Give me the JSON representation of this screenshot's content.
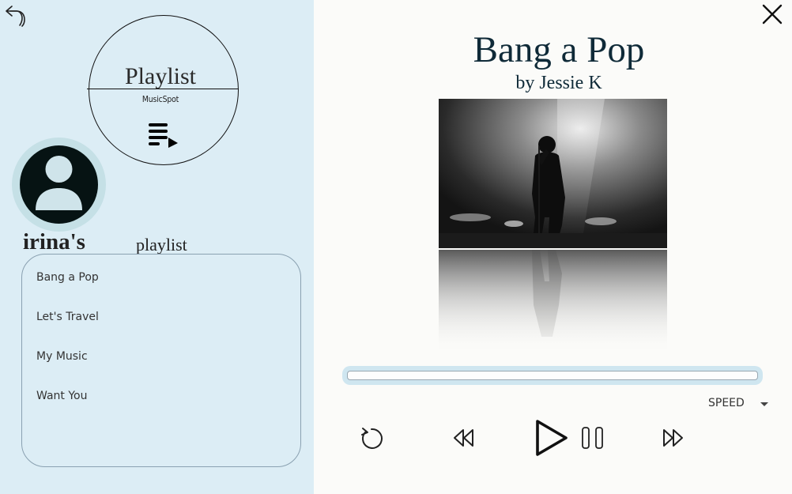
{
  "header": {
    "back_icon": "undo-arrow-icon",
    "close_icon": "close-x-icon"
  },
  "logo": {
    "title": "Playlist",
    "subtitle": "MusicSpot",
    "icon": "playlist-play-icon"
  },
  "user": {
    "avatar_icon": "user-avatar-icon",
    "name": "irina's",
    "suffix": "playlist"
  },
  "playlist": {
    "items": [
      {
        "label": "Bang a Pop"
      },
      {
        "label": "Let's Travel"
      },
      {
        "label": "My Music"
      },
      {
        "label": "Want You"
      }
    ]
  },
  "now_playing": {
    "title": "Bang a Pop",
    "artist": "by Jessie K",
    "progress_fraction": 0.0
  },
  "controls": {
    "speed_label": "SPEED",
    "replay_icon": "replay-icon",
    "rewind_icon": "rewind-icon",
    "play_icon": "play-icon",
    "pause_icon": "pause-icon",
    "forward_icon": "fast-forward-icon"
  },
  "colors": {
    "left_panel": "#dcedf5",
    "title_text": "#0f2a38",
    "avatar_bg": "#061313",
    "avatar_ring": "#c5e0e6"
  }
}
